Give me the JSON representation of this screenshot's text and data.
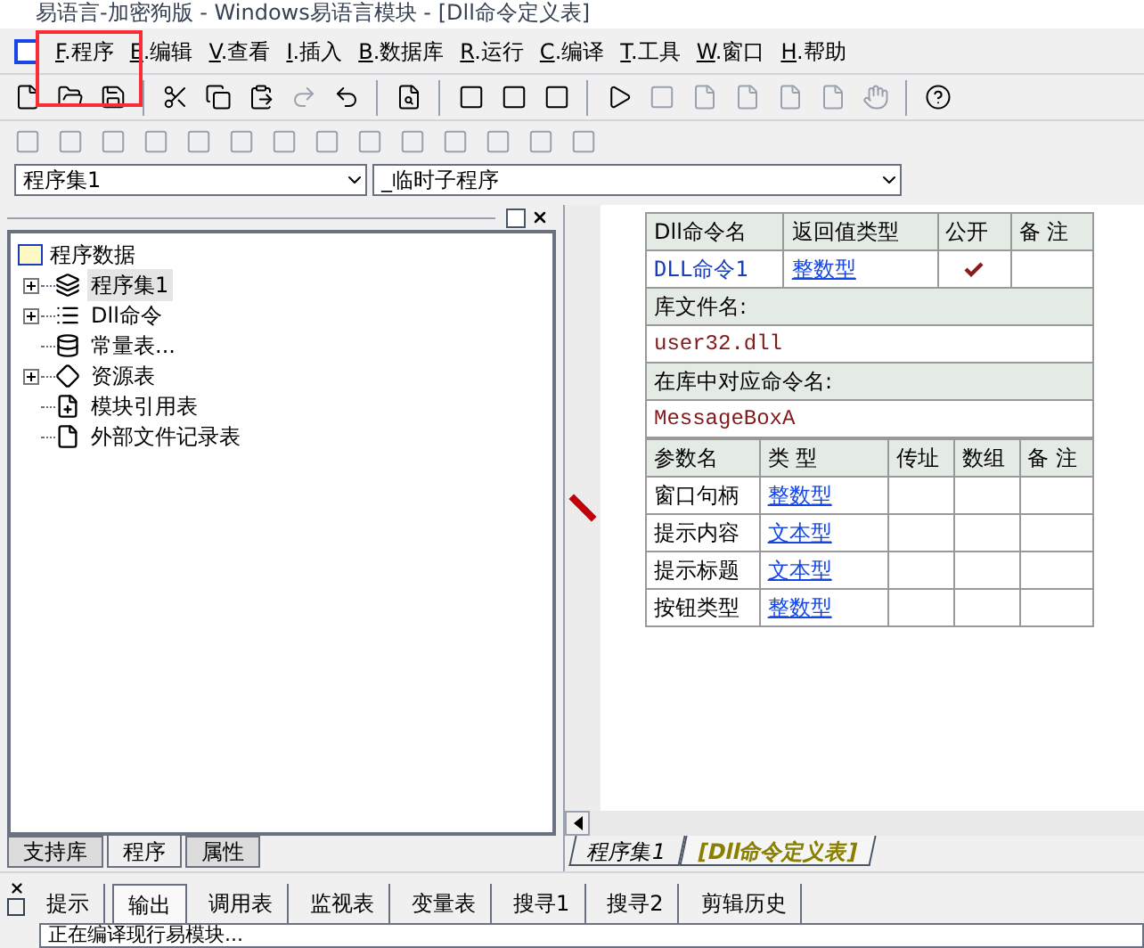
{
  "window": {
    "title": "易语言-加密狗版 - Windows易语言模块 - [Dll命令定义表]"
  },
  "menu": [
    "F.程序",
    "E.编辑",
    "V.查看",
    "I.插入",
    "B.数据库",
    "R.运行",
    "C.编译",
    "T.工具",
    "W.窗口",
    "H.帮助"
  ],
  "selectors": [
    {
      "value": "程序集1"
    },
    {
      "value": "_临时子程序"
    }
  ],
  "tree": {
    "label": "程序数据",
    "children": [
      {
        "label": "程序集1",
        "expander": true,
        "selected": true
      },
      {
        "label": "Dll命令",
        "expander": true,
        "selected": false
      },
      {
        "label": "常量表...",
        "expander": false,
        "selected": false
      },
      {
        "label": "资源表",
        "expander": true,
        "selected": false
      },
      {
        "label": "模块引用表",
        "expander": false,
        "selected": false
      },
      {
        "label": "外部文件记录表",
        "expander": false,
        "selected": false
      }
    ]
  },
  "left_tabs": [
    {
      "label": "支持库",
      "selected": false
    },
    {
      "label": "程序",
      "selected": true
    },
    {
      "label": "属性",
      "selected": false
    }
  ],
  "dll_table": {
    "columns": [
      "Dll命令名",
      "返回值类型",
      "公开",
      "备 注"
    ],
    "row": {
      "name": "DLL命令1",
      "return_type": "整数型",
      "public": true
    },
    "library_label": "库文件名:",
    "library": "user32.dll",
    "command_label": "在库中对应命令名:",
    "command": "MessageBoxA",
    "param_columns": [
      "参数名",
      "类 型",
      "传址",
      "数组",
      "备 注"
    ],
    "params": [
      {
        "name": "窗口句柄",
        "type": "整数型"
      },
      {
        "name": "提示内容",
        "type": "文本型"
      },
      {
        "name": "提示标题",
        "type": "文本型"
      },
      {
        "name": "按钮类型",
        "type": "整数型"
      }
    ]
  },
  "doc_tabs": [
    {
      "label": "程序集1",
      "selected": false
    },
    {
      "label": "[Dll命令定义表]",
      "selected": true
    }
  ],
  "output_tabs": [
    {
      "label": "提示",
      "selected": false
    },
    {
      "label": "输出",
      "selected": true
    },
    {
      "label": "调用表",
      "selected": false
    },
    {
      "label": "监视表",
      "selected": false
    },
    {
      "label": "变量表",
      "selected": false
    },
    {
      "label": "搜寻1",
      "selected": false
    },
    {
      "label": "搜寻2",
      "selected": false
    },
    {
      "label": "剪辑历史",
      "selected": false
    }
  ],
  "output_text": "正在编译现行易模块..."
}
